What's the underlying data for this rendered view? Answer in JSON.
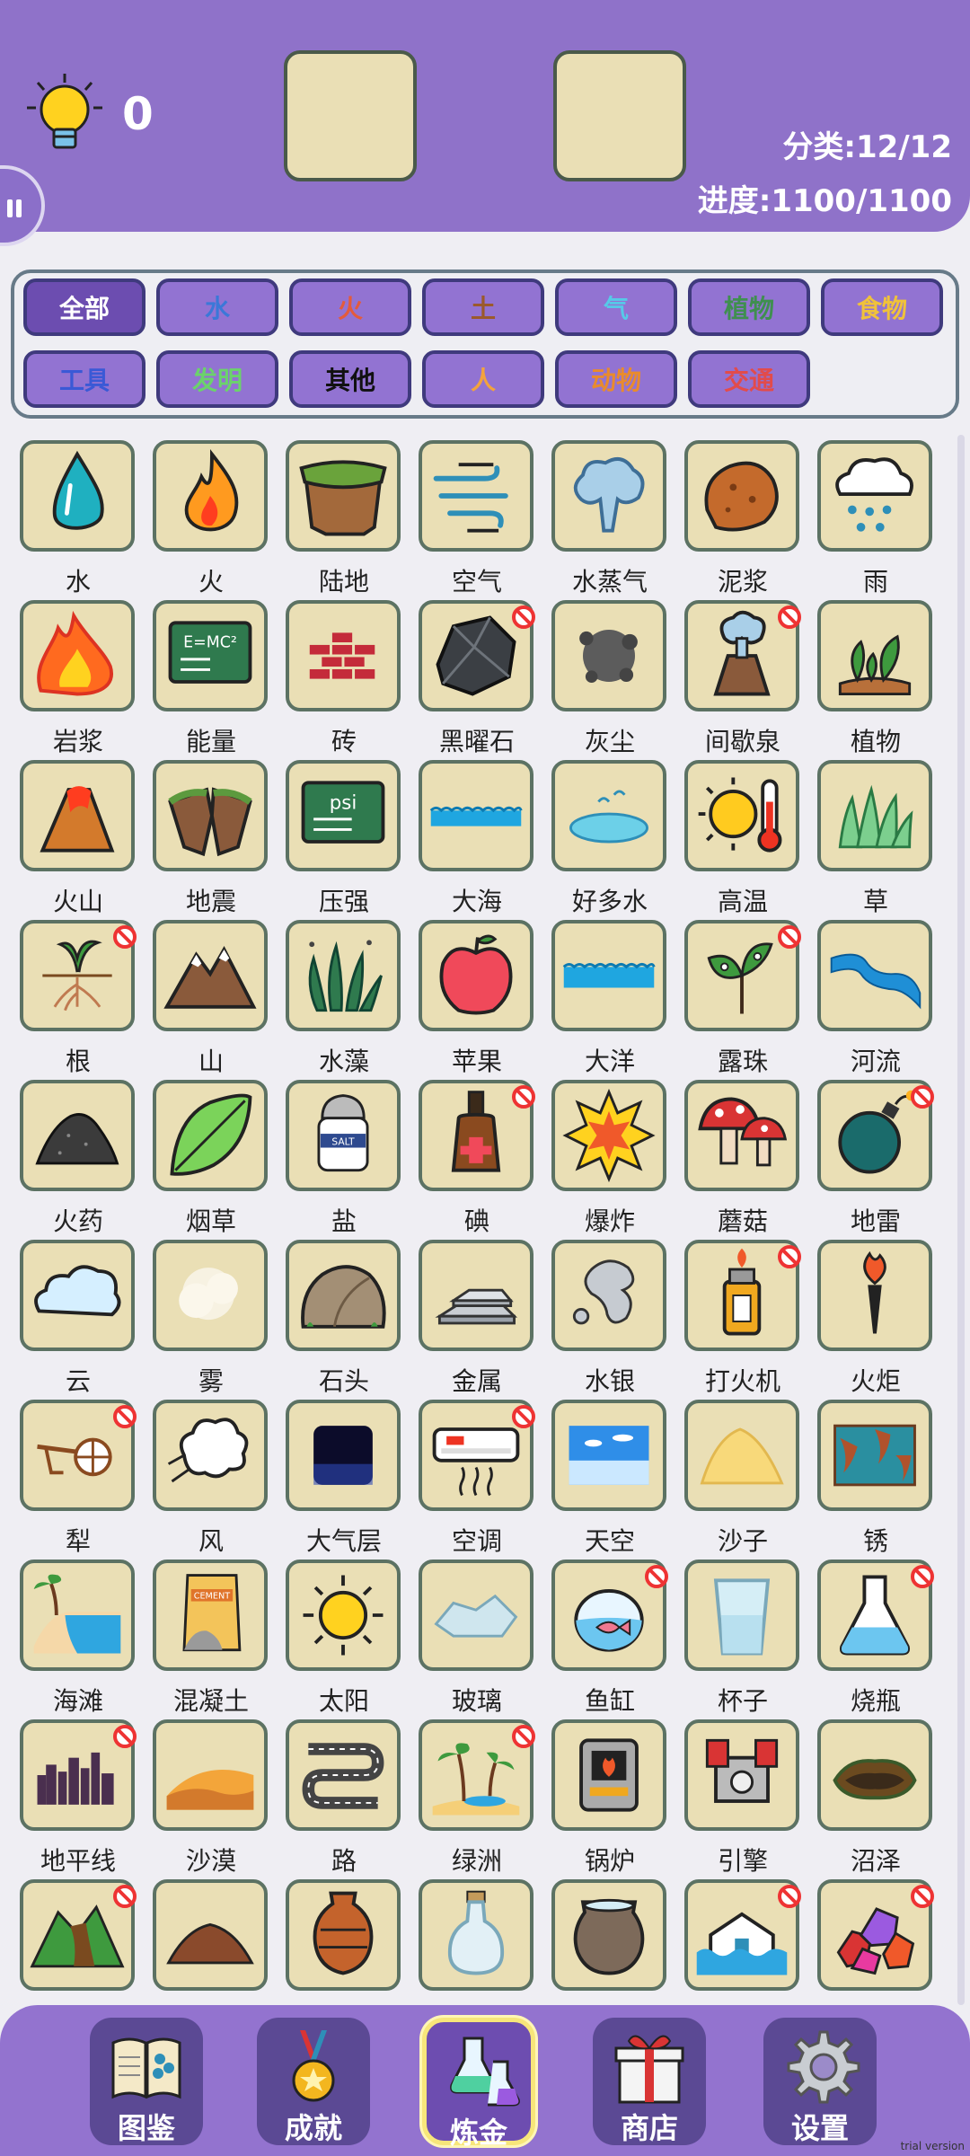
{
  "header": {
    "hint_count": "0",
    "category_text": "分类:12/12",
    "progress_text": "进度:1100/1100"
  },
  "filters": [
    {
      "label": "全部",
      "color": "#ffffff",
      "active": true
    },
    {
      "label": "水",
      "color": "#3b78d8"
    },
    {
      "label": "火",
      "color": "#e35b3c"
    },
    {
      "label": "土",
      "color": "#9b5a2c"
    },
    {
      "label": "气",
      "color": "#57c9e8"
    },
    {
      "label": "植物",
      "color": "#3f8f4f"
    },
    {
      "label": "食物",
      "color": "#f0c23a"
    },
    {
      "label": "工具",
      "color": "#3a59d6"
    },
    {
      "label": "发明",
      "color": "#6bd36b"
    },
    {
      "label": "其他",
      "color": "#111111"
    },
    {
      "label": "人",
      "color": "#f3a33d"
    },
    {
      "label": "动物",
      "color": "#e98b2c"
    },
    {
      "label": "交通",
      "color": "#e24b4b"
    }
  ],
  "items": [
    {
      "label": "水",
      "icon": "water-drop-icon",
      "locked": false
    },
    {
      "label": "火",
      "icon": "fire-icon",
      "locked": false
    },
    {
      "label": "陆地",
      "icon": "land-icon",
      "locked": false
    },
    {
      "label": "空气",
      "icon": "air-icon",
      "locked": false
    },
    {
      "label": "水蒸气",
      "icon": "steam-icon",
      "locked": false
    },
    {
      "label": "泥浆",
      "icon": "mud-icon",
      "locked": false
    },
    {
      "label": "雨",
      "icon": "rain-icon",
      "locked": false
    },
    {
      "label": "岩浆",
      "icon": "lava-icon",
      "locked": false
    },
    {
      "label": "能量",
      "icon": "energy-board-icon",
      "locked": false
    },
    {
      "label": "砖",
      "icon": "brick-icon",
      "locked": false
    },
    {
      "label": "黑曜石",
      "icon": "obsidian-icon",
      "locked": true
    },
    {
      "label": "灰尘",
      "icon": "dust-icon",
      "locked": false
    },
    {
      "label": "间歇泉",
      "icon": "geyser-icon",
      "locked": true
    },
    {
      "label": "植物",
      "icon": "plant-icon",
      "locked": false
    },
    {
      "label": "火山",
      "icon": "volcano-icon",
      "locked": false
    },
    {
      "label": "地震",
      "icon": "earthquake-icon",
      "locked": false
    },
    {
      "label": "压强",
      "icon": "pressure-board-icon",
      "locked": false
    },
    {
      "label": "大海",
      "icon": "sea-icon",
      "locked": false
    },
    {
      "label": "好多水",
      "icon": "puddle-icon",
      "locked": false
    },
    {
      "label": "高温",
      "icon": "heat-icon",
      "locked": false
    },
    {
      "label": "草",
      "icon": "grass-icon",
      "locked": false
    },
    {
      "label": "根",
      "icon": "root-icon",
      "locked": true
    },
    {
      "label": "山",
      "icon": "mountain-icon",
      "locked": false
    },
    {
      "label": "水藻",
      "icon": "seaweed-icon",
      "locked": false
    },
    {
      "label": "苹果",
      "icon": "apple-icon",
      "locked": false
    },
    {
      "label": "大洋",
      "icon": "ocean-icon",
      "locked": false
    },
    {
      "label": "露珠",
      "icon": "dew-icon",
      "locked": true
    },
    {
      "label": "河流",
      "icon": "river-icon",
      "locked": false
    },
    {
      "label": "火药",
      "icon": "gunpowder-icon",
      "locked": false
    },
    {
      "label": "烟草",
      "icon": "tobacco-leaf-icon",
      "locked": false
    },
    {
      "label": "盐",
      "icon": "salt-icon",
      "locked": false
    },
    {
      "label": "碘",
      "icon": "iodine-icon",
      "locked": true
    },
    {
      "label": "爆炸",
      "icon": "explosion-icon",
      "locked": false
    },
    {
      "label": "蘑菇",
      "icon": "mushroom-icon",
      "locked": false
    },
    {
      "label": "地雷",
      "icon": "mine-icon",
      "locked": true
    },
    {
      "label": "云",
      "icon": "cloud-icon",
      "locked": false
    },
    {
      "label": "雾",
      "icon": "fog-icon",
      "locked": false
    },
    {
      "label": "石头",
      "icon": "stone-icon",
      "locked": false
    },
    {
      "label": "金属",
      "icon": "metal-icon",
      "locked": false
    },
    {
      "label": "水银",
      "icon": "mercury-icon",
      "locked": false
    },
    {
      "label": "打火机",
      "icon": "lighter-icon",
      "locked": true
    },
    {
      "label": "火炬",
      "icon": "torch-icon",
      "locked": false
    },
    {
      "label": "犁",
      "icon": "plow-icon",
      "locked": true
    },
    {
      "label": "风",
      "icon": "wind-icon",
      "locked": false
    },
    {
      "label": "大气层",
      "icon": "atmosphere-icon",
      "locked": false
    },
    {
      "label": "空调",
      "icon": "air-conditioner-icon",
      "locked": true
    },
    {
      "label": "天空",
      "icon": "sky-icon",
      "locked": false
    },
    {
      "label": "沙子",
      "icon": "sand-icon",
      "locked": false
    },
    {
      "label": "锈",
      "icon": "rust-icon",
      "locked": false
    },
    {
      "label": "海滩",
      "icon": "beach-icon",
      "locked": false
    },
    {
      "label": "混凝土",
      "icon": "cement-icon",
      "locked": false
    },
    {
      "label": "太阳",
      "icon": "sun-icon",
      "locked": false
    },
    {
      "label": "玻璃",
      "icon": "glass-icon",
      "locked": false
    },
    {
      "label": "鱼缸",
      "icon": "fishbowl-icon",
      "locked": true
    },
    {
      "label": "杯子",
      "icon": "cup-icon",
      "locked": false
    },
    {
      "label": "烧瓶",
      "icon": "flask-icon",
      "locked": true
    },
    {
      "label": "地平线",
      "icon": "horizon-icon",
      "locked": true
    },
    {
      "label": "沙漠",
      "icon": "desert-icon",
      "locked": false
    },
    {
      "label": "路",
      "icon": "road-icon",
      "locked": false
    },
    {
      "label": "绿洲",
      "icon": "oasis-icon",
      "locked": true
    },
    {
      "label": "锅炉",
      "icon": "boiler-icon",
      "locked": false
    },
    {
      "label": "引擎",
      "icon": "engine-icon",
      "locked": false
    },
    {
      "label": "沼泽",
      "icon": "swamp-icon",
      "locked": false
    },
    {
      "label": "泥石流",
      "icon": "mudslide-icon",
      "locked": true
    },
    {
      "label": "黏土",
      "icon": "clay-icon",
      "locked": false
    },
    {
      "label": "陶器",
      "icon": "pottery-icon",
      "locked": false
    },
    {
      "label": "瓶子",
      "icon": "bottle-icon",
      "locked": false
    },
    {
      "label": "水缸",
      "icon": "water-jar-icon",
      "locked": false
    },
    {
      "label": "洪水",
      "icon": "flood-icon",
      "locked": true
    },
    {
      "label": "宝石",
      "icon": "gems-icon",
      "locked": true
    }
  ],
  "nav": [
    {
      "label": "图鉴",
      "icon": "book-icon",
      "active": false
    },
    {
      "label": "成就",
      "icon": "medal-icon",
      "active": false
    },
    {
      "label": "炼金",
      "icon": "alchemy-flask-icon",
      "active": true
    },
    {
      "label": "商店",
      "icon": "gift-icon",
      "active": false
    },
    {
      "label": "设置",
      "icon": "gear-icon",
      "active": false
    }
  ],
  "watermark": "trial version"
}
